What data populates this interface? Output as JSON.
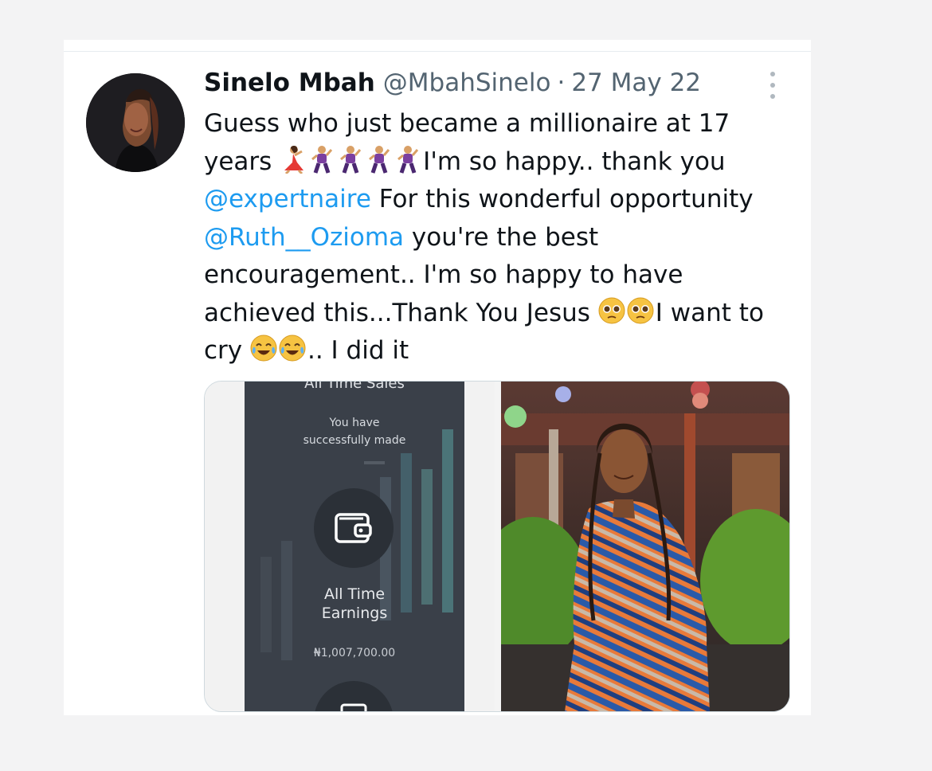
{
  "tweet": {
    "display_name": "Sinelo Mbah",
    "handle": "@MbahSinelo",
    "separator": "·",
    "date": "27 May 22",
    "text_segments": {
      "s1": "Guess who just became a millionaire at 17 years ",
      "s2": "I'm so happy.. thank you ",
      "mention1": "@expertnaire",
      "s3": " For this wonderful opportunity ",
      "mention2": "@Ruth__Ozioma",
      "s4": " you're the best encouragement.. I'm so happy to have achieved this...Thank You Jesus ",
      "s5": "I want to cry ",
      "s6": ".. I did it"
    },
    "emojis": {
      "dancer": "woman-dancing-emoji",
      "man_dancing": "man-dancing-emoji",
      "pleading": "pleading-face-emoji",
      "laughing": "face-with-tears-of-joy-emoji"
    }
  },
  "media": {
    "screenshot": {
      "heading": "All Time Sales",
      "line1": "You have",
      "line2": "successfully made",
      "earnings_label_1": "All Time",
      "earnings_label_2": "Earnings",
      "earnings_value": "₦1,007,700.00"
    },
    "photo": "girl-in-striped-dress-photo"
  },
  "colors": {
    "link": "#1d9bf0",
    "text": "#0f1419",
    "muted": "#536471",
    "phone_bg": "#3a4049"
  }
}
